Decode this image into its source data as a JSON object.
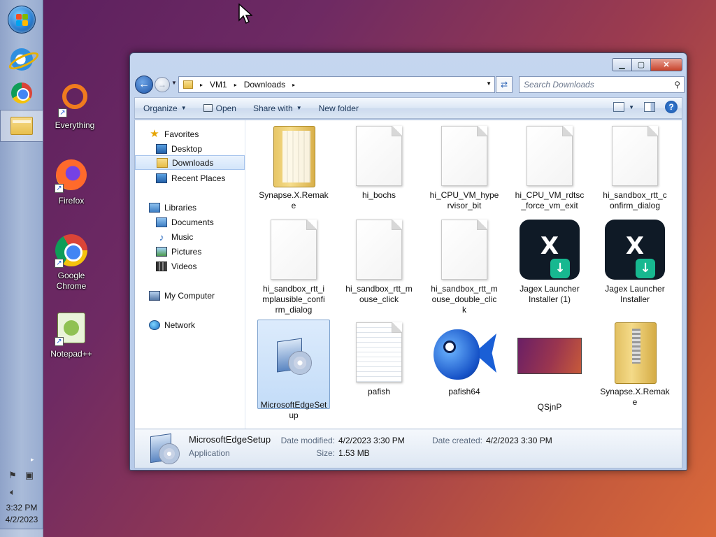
{
  "taskbar": {
    "pinned": [
      {
        "icon": "internet-explorer-icon"
      },
      {
        "icon": "chrome-icon"
      },
      {
        "icon": "windows-explorer-icon",
        "active": true
      }
    ],
    "tray_expand": "▸",
    "clock_time": "3:32 PM",
    "clock_date": "4/2/2023"
  },
  "desktop": {
    "icons": [
      {
        "label": "Everything"
      },
      {
        "label": "Firefox"
      },
      {
        "label": "Google Chrome"
      },
      {
        "label": "Notepad++"
      }
    ],
    "shortcut_arrow": "↗"
  },
  "window": {
    "controls": {
      "minimize": "▁",
      "maximize": "▢",
      "close": "✕"
    },
    "nav": {
      "back": "←",
      "forward": "→"
    },
    "address": {
      "segments": [
        "VM1",
        "Downloads"
      ],
      "separator": "▸"
    },
    "search": {
      "placeholder": "Search Downloads"
    },
    "toolbar": {
      "organize": "Organize",
      "open": "Open",
      "share_with": "Share with",
      "new_folder": "New folder",
      "help": "?"
    },
    "navpane": {
      "favorites": "Favorites",
      "desktop": "Desktop",
      "downloads": "Downloads",
      "recent_places": "Recent Places",
      "libraries": "Libraries",
      "documents": "Documents",
      "music": "Music",
      "pictures": "Pictures",
      "videos": "Videos",
      "my_computer": "My Computer",
      "network": "Network"
    },
    "files": [
      {
        "name": "Synapse.X.Remak",
        "name2": "e",
        "kind": "folder"
      },
      {
        "name": "hi_bochs",
        "name2": "",
        "kind": "document"
      },
      {
        "name": "hi_CPU_VM_hype",
        "name2": "rvisor_bit",
        "kind": "document"
      },
      {
        "name": "hi_CPU_VM_rdtsc",
        "name2": "_force_vm_exit",
        "kind": "document"
      },
      {
        "name": "hi_sandbox_rtt_c",
        "name2": "onfirm_dialog",
        "kind": "document"
      },
      {
        "name": "hi_sandbox_rtt_i",
        "name2": "mplausible_confi",
        "name3": "rm_dialog",
        "kind": "document"
      },
      {
        "name": "hi_sandbox_rtt_m",
        "name2": "ouse_click",
        "kind": "document"
      },
      {
        "name": "hi_sandbox_rtt_m",
        "name2": "ouse_double_clic",
        "name3": "k",
        "kind": "document"
      },
      {
        "name": "Jagex Launcher",
        "name2": "Installer (1)",
        "kind": "jagex",
        "glyph": "X",
        "dl": "↓"
      },
      {
        "name": "Jagex Launcher",
        "name2": "Installer",
        "kind": "jagex",
        "glyph": "X",
        "dl": "↓"
      },
      {
        "name": "MicrosoftEdgeSet",
        "name2": "up",
        "kind": "setup",
        "selected": true
      },
      {
        "name": "pafish",
        "name2": "",
        "kind": "text-document"
      },
      {
        "name": "pafish64",
        "name2": "",
        "kind": "fish"
      },
      {
        "name": "QSjnP",
        "name2": "",
        "kind": "image"
      },
      {
        "name": "Synapse.X.Remak",
        "name2": "e",
        "kind": "zip-folder"
      }
    ],
    "details": {
      "name": "MicrosoftEdgeSetup",
      "type": "Application",
      "date_modified_label": "Date modified:",
      "date_modified": "4/2/2023 3:30 PM",
      "size_label": "Size:",
      "size": "1.53 MB",
      "date_created_label": "Date created:",
      "date_created": "4/2/2023 3:30 PM"
    }
  }
}
